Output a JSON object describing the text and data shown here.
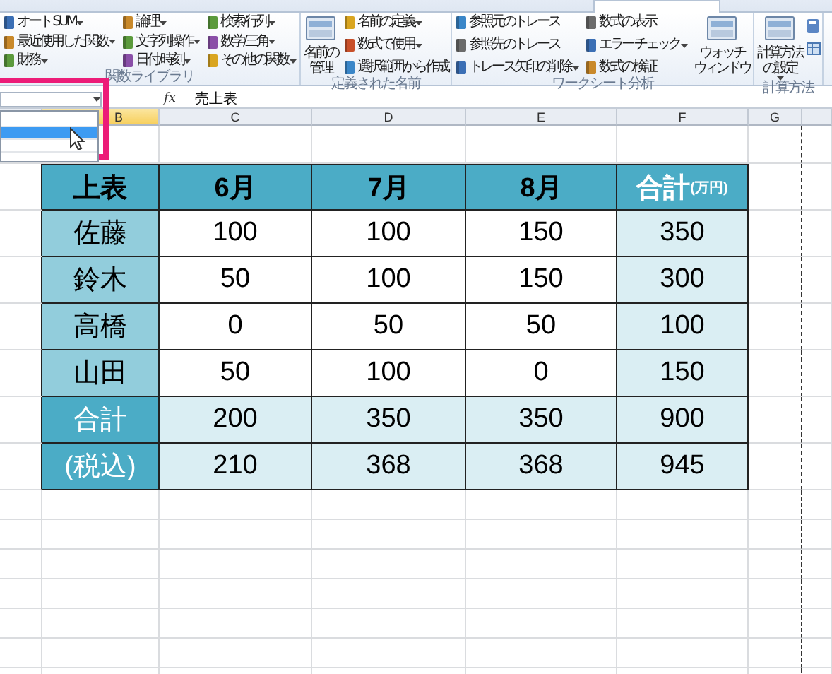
{
  "ribbon": {
    "groups": [
      {
        "label": "関数ライブラリ",
        "items": [
          {
            "kind": "stack",
            "entries": [
              {
                "label": "オート SUM",
                "dropdown": true
              },
              {
                "label": "最近使用した関数",
                "dropdown": true
              },
              {
                "label": "財務",
                "dropdown": true
              }
            ]
          },
          {
            "kind": "stack",
            "entries": [
              {
                "label": "論理",
                "dropdown": true
              },
              {
                "label": "文字列操作",
                "dropdown": true
              },
              {
                "label": "日付/時刻",
                "dropdown": true
              }
            ]
          },
          {
            "kind": "stack",
            "entries": [
              {
                "label": "検索/行列",
                "dropdown": true
              },
              {
                "label": "数学/三角",
                "dropdown": true
              },
              {
                "label": "その他の関数",
                "dropdown": true
              }
            ]
          }
        ]
      },
      {
        "label": "定義された名前",
        "items": [
          {
            "kind": "large",
            "lines": [
              "名前の",
              "管理"
            ],
            "dropdown": false
          },
          {
            "kind": "stack",
            "entries": [
              {
                "label": "名前の定義",
                "dropdown": true
              },
              {
                "label": "数式で使用",
                "dropdown": true
              },
              {
                "label": "選択範囲から作成",
                "dropdown": false
              }
            ]
          }
        ]
      },
      {
        "label": "ワークシート分析",
        "items": [
          {
            "kind": "stack",
            "entries": [
              {
                "label": "参照元のトレース",
                "dropdown": false
              },
              {
                "label": "参照先のトレース",
                "dropdown": false
              },
              {
                "label": "トレース矢印の削除",
                "dropdown": true
              }
            ]
          },
          {
            "kind": "stack",
            "entries": [
              {
                "label": "数式の表示",
                "dropdown": false
              },
              {
                "label": "エラー チェック",
                "dropdown": true
              },
              {
                "label": "数式の検証",
                "dropdown": false
              }
            ]
          },
          {
            "kind": "large",
            "lines": [
              "ウォッチ",
              "ウィンドウ"
            ],
            "dropdown": false
          }
        ]
      },
      {
        "label": "計算方法",
        "items": [
          {
            "kind": "large",
            "lines": [
              "計算方法",
              "の設定"
            ],
            "dropdown": true
          },
          {
            "kind": "icons"
          }
        ]
      }
    ]
  },
  "formula_bar": {
    "function_label": "fx",
    "value": "売上表"
  },
  "name_box": {
    "dropdown_list": [
      {
        "selected": false
      },
      {
        "selected": true
      },
      {
        "selected": false
      }
    ]
  },
  "columns": [
    {
      "label": "B",
      "selected": true
    },
    {
      "label": "C",
      "selected": false
    },
    {
      "label": "D",
      "selected": false
    },
    {
      "label": "E",
      "selected": false
    },
    {
      "label": "F",
      "selected": false
    },
    {
      "label": "G",
      "selected": false
    }
  ],
  "table": {
    "header": [
      {
        "text": "上表"
      },
      {
        "text": "6月"
      },
      {
        "text": "7月"
      },
      {
        "text": "8月"
      },
      {
        "text": "合計",
        "note": "(万円)"
      }
    ],
    "rows": [
      {
        "kind": "person",
        "label": "佐藤",
        "values": [
          "100",
          "100",
          "150",
          "350"
        ]
      },
      {
        "kind": "person",
        "label": "鈴木",
        "values": [
          "50",
          "100",
          "150",
          "300"
        ]
      },
      {
        "kind": "person",
        "label": "高橋",
        "values": [
          "0",
          "50",
          "50",
          "100"
        ]
      },
      {
        "kind": "person",
        "label": "山田",
        "values": [
          "50",
          "100",
          "0",
          "150"
        ]
      },
      {
        "kind": "total",
        "label": "合計",
        "values": [
          "200",
          "350",
          "350",
          "900"
        ]
      },
      {
        "kind": "total",
        "label": "(税込)",
        "values": [
          "210",
          "368",
          "368",
          "945"
        ]
      }
    ]
  }
}
